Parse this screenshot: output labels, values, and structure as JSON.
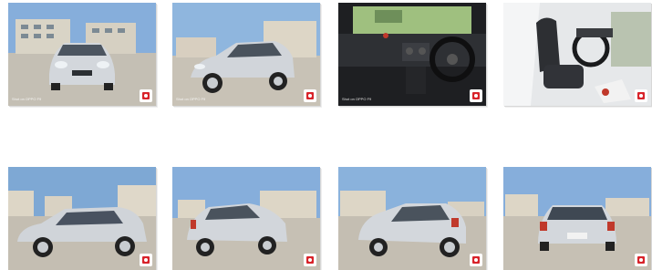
{
  "gallery": {
    "items": [
      {
        "view": "front",
        "watermark": "Shot on OPPO F9"
      },
      {
        "view": "front-left quarter",
        "watermark": "Shot on OPPO F9"
      },
      {
        "view": "dashboard",
        "watermark": "Shot on OPPO F9"
      },
      {
        "view": "front seats",
        "watermark": ""
      },
      {
        "view": "left side",
        "watermark": ""
      },
      {
        "view": "rear-left quarter",
        "watermark": ""
      },
      {
        "view": "rear-left",
        "watermark": ""
      },
      {
        "view": "rear",
        "watermark": ""
      }
    ],
    "logo_icon": "red-square-logo-icon",
    "colors": {
      "car_body": "#cfd3d8",
      "sky": "#7fa9d6",
      "ground": "#bdb8ad",
      "logo": "#d8232a"
    }
  }
}
